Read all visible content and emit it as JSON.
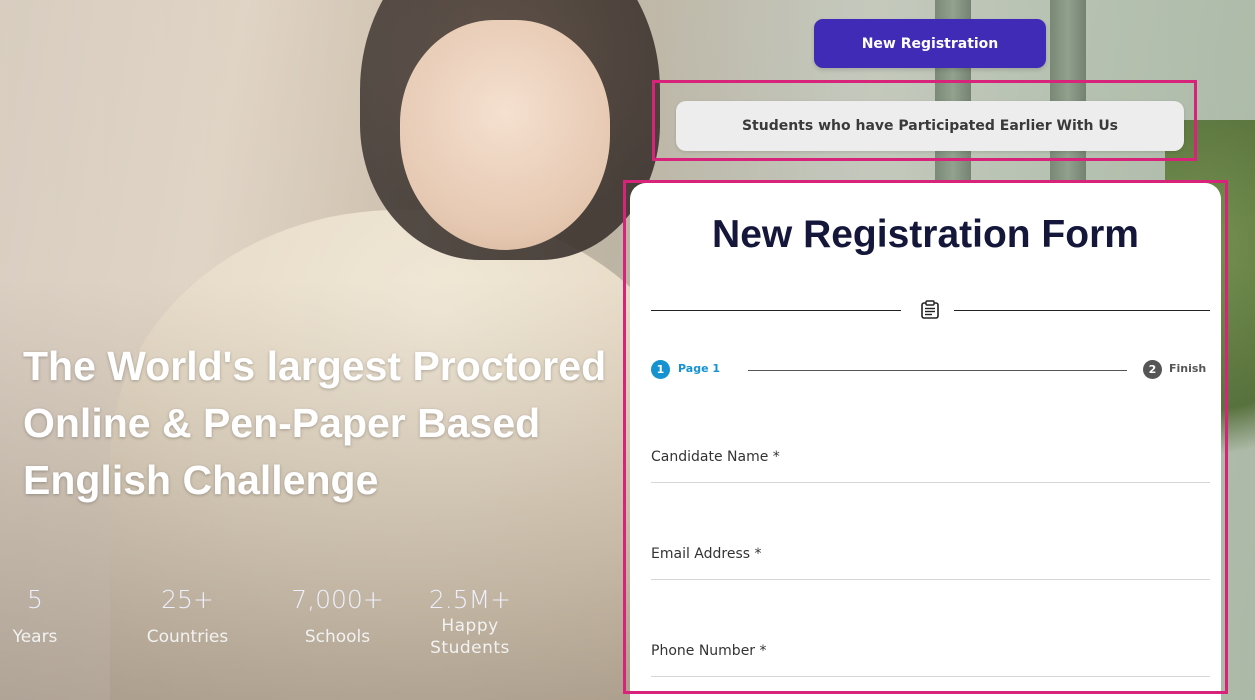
{
  "hero": {
    "title": "The World's largest Proctored Online & Pen-Paper Based English Challenge",
    "stats": [
      {
        "value": "5",
        "label": "Years"
      },
      {
        "value": "25+",
        "label": "Countries"
      },
      {
        "value": "7,000+",
        "label": "Schools"
      },
      {
        "value": "2.5M+",
        "label": "Happy Students"
      }
    ]
  },
  "buttons": {
    "new_registration": "New Registration",
    "participated_earlier": "Students who have Participated Earlier With Us"
  },
  "form": {
    "title": "New Registration Form",
    "steps": [
      {
        "number": "1",
        "label": "Page 1"
      },
      {
        "number": "2",
        "label": "Finish"
      }
    ],
    "fields": [
      {
        "label": "Candidate Name *",
        "value": ""
      },
      {
        "label": "Email Address *",
        "value": ""
      },
      {
        "label": "Phone Number *",
        "value": ""
      }
    ]
  },
  "colors": {
    "primary_button": "#3f2bb5",
    "highlight_border": "#d8237a",
    "step_active": "#1592cf",
    "form_title": "#14163a"
  }
}
